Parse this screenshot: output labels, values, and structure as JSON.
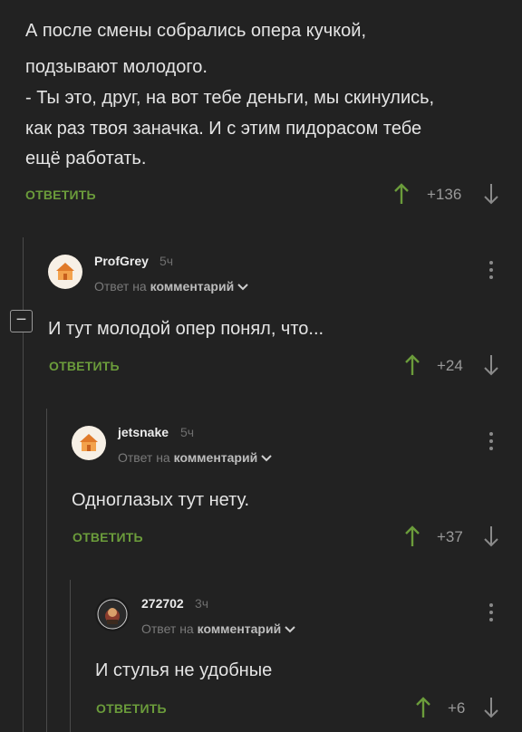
{
  "colors": {
    "background": "#222222",
    "accent_green": "#6b9c3b",
    "text": "#e4e4e4",
    "muted": "#8a8a8a"
  },
  "comment0": {
    "lines": [
      "А после смены собрались опера кучкой,",
      "подзывают молодого.",
      "- Ты это, друг, на вот тебе деньги, мы скинулись,",
      "как раз твоя заначка. И с этим пидорасом тебе",
      "ещё работать."
    ],
    "reply_label": "ОТВЕТИТЬ",
    "rating": "+136"
  },
  "comment1": {
    "username": "ProfGrey",
    "time": "5ч",
    "reply_prefix": "Ответ на",
    "reply_target": "комментарий",
    "text": "И тут молодой опер понял, что...",
    "reply_label": "ОТВЕТИТЬ",
    "rating": "+24",
    "collapse_symbol": "−"
  },
  "comment2": {
    "username": "jetsnake",
    "time": "5ч",
    "reply_prefix": "Ответ на",
    "reply_target": "комментарий",
    "text": "Одноглазых тут нету.",
    "reply_label": "ОТВЕТИТЬ",
    "rating": "+37"
  },
  "comment3": {
    "username": "272702",
    "time": "3ч",
    "reply_prefix": "Ответ на",
    "reply_target": "комментарий",
    "text": "И стулья не удобные",
    "reply_label": "ОТВЕТИТЬ",
    "rating": "+6"
  }
}
